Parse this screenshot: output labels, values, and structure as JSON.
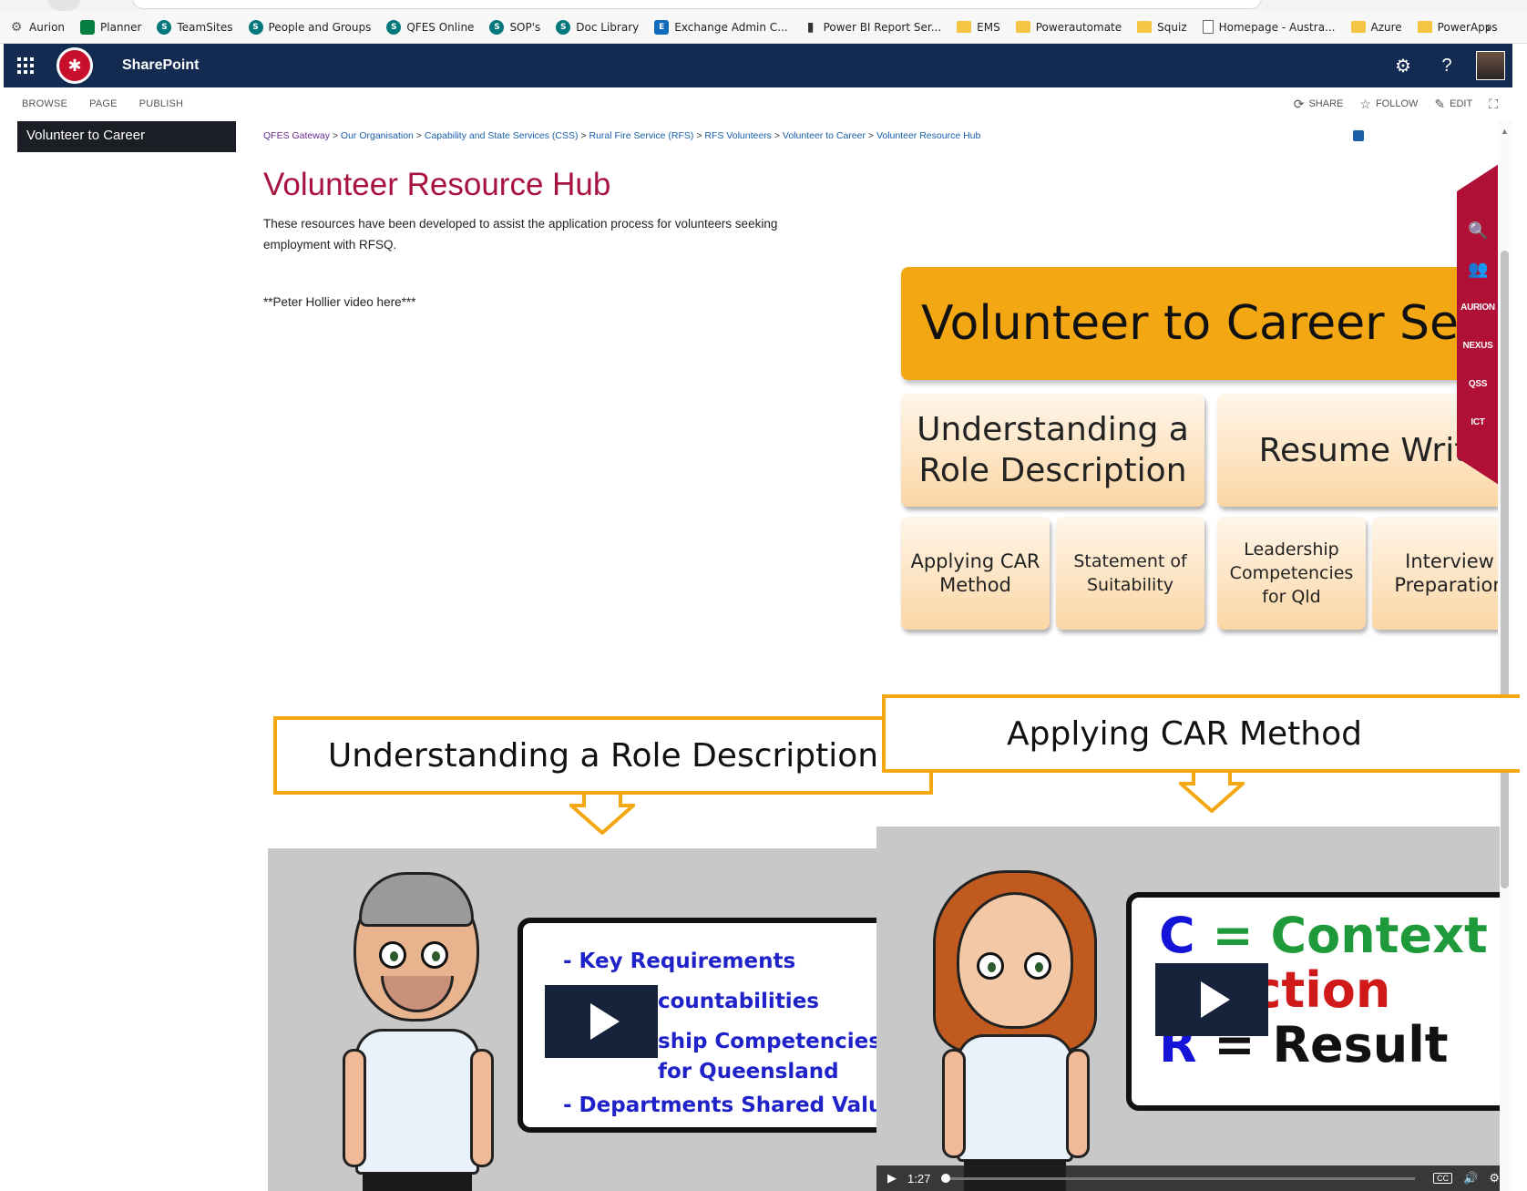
{
  "bookmarks": [
    {
      "label": "Aurion",
      "icon": "gear-icon"
    },
    {
      "label": "Planner",
      "icon": "planner-icon"
    },
    {
      "label": "TeamSites",
      "icon": "sharepoint-icon"
    },
    {
      "label": "People and Groups",
      "icon": "sharepoint-icon"
    },
    {
      "label": "QFES Online",
      "icon": "sharepoint-icon"
    },
    {
      "label": "SOP's",
      "icon": "sharepoint-icon"
    },
    {
      "label": "Doc Library",
      "icon": "sharepoint-icon"
    },
    {
      "label": "Exchange Admin C...",
      "icon": "exchange-icon"
    },
    {
      "label": "Power BI Report Ser...",
      "icon": "power-bi-icon"
    },
    {
      "label": "EMS",
      "icon": "folder-icon"
    },
    {
      "label": "Powerautomate",
      "icon": "folder-icon"
    },
    {
      "label": "Squiz",
      "icon": "folder-icon"
    },
    {
      "label": "Homepage - Austra...",
      "icon": "page-icon"
    },
    {
      "label": "Azure",
      "icon": "folder-icon"
    },
    {
      "label": "PowerApps",
      "icon": "folder-icon"
    }
  ],
  "suitebar": {
    "title": "SharePoint"
  },
  "ribbon": {
    "tabs": [
      "BROWSE",
      "PAGE",
      "PUBLISH"
    ],
    "share": "SHARE",
    "follow": "FOLLOW",
    "edit": "EDIT"
  },
  "leftnav": {
    "current": "Volunteer to Career"
  },
  "breadcrumb": [
    "QFES Gateway",
    "Our Organisation",
    "Capability and State Services (CSS)",
    "Rural Fire Service (RFS)",
    "RFS Volunteers",
    "Volunteer to Career",
    "Volunteer Resource Hub"
  ],
  "breadcrumb_sep": " > ",
  "page": {
    "title": "Volunteer Resource Hub",
    "intro": "These resources have been developed to assist the application process for volunteers seeking employment with RFSQ.",
    "note": "**Peter Hollier video here***"
  },
  "series": {
    "header": "Volunteer to Career Seri",
    "tiles_big": [
      "Understanding a\nRole Description",
      "Resume Writi"
    ],
    "tiles_small": [
      "Applying CAR\nMethod",
      "Statement of\nSuitability",
      "Leadership\nCompetencies\nfor Qld",
      "Interview\nPreparation"
    ]
  },
  "quicklinks": [
    "search-people-icon",
    "people-icon",
    "AURION",
    "NEXUS",
    "QSS",
    "ICT"
  ],
  "callouts": {
    "left": "Understanding a Role Description",
    "right": "Applying CAR Method"
  },
  "video_left": {
    "board": [
      "- Key Requirements",
      "countabilities",
      "ship Competencies",
      "for Queensland",
      "- Departments Shared Value"
    ]
  },
  "video_right": {
    "car": [
      {
        "letter": "C",
        "rest": "= Context",
        "letter_color": "#1414d8",
        "rest_color": "#1f9a3a"
      },
      {
        "letter": "A",
        "rest": "Action",
        "letter_color": "#1414d8",
        "rest_color": "#d01a1a"
      },
      {
        "letter": "R",
        "rest": "= Result",
        "letter_color": "#1414d8",
        "rest_color": "#111111"
      }
    ],
    "time": "1:27",
    "cc": "CC"
  },
  "colors": {
    "suite_bar": "#132b50",
    "title_red": "#a8123e",
    "accent_orange": "#f3a712",
    "quicklinks_red": "#b01035"
  }
}
